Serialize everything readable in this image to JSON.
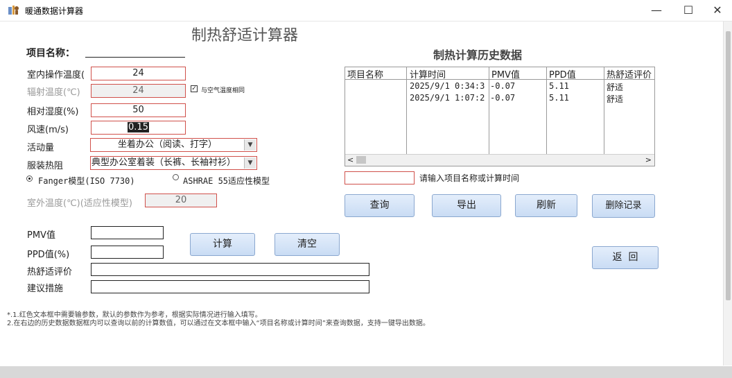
{
  "window": {
    "title": "暖通数据计算器",
    "min_glyph": "—",
    "max_glyph": "☐",
    "close_glyph": "✕"
  },
  "form": {
    "heading": "制热舒适计算器",
    "project_name_label": "项目名称：",
    "project_name_value": "",
    "indoor_temp_label": "室内操作温度(",
    "indoor_temp_value": "24",
    "radiant_temp_label": "辐射温度(℃)",
    "radiant_temp_value": "24",
    "same_as_air_label": "与空气温度相同",
    "same_as_air_checked": true,
    "humidity_label": "相对湿度(%)",
    "humidity_value": "50",
    "wind_label": "风速(m/s)",
    "wind_value": "0.15",
    "activity_label": "活动量",
    "activity_value": "坐着办公（阅读、打字）",
    "clothing_label": "服装热阻",
    "clothing_value": "典型办公室着装（长裤、长袖衬衫）",
    "model_fanger_label": "Fanger模型(ISO 7730)",
    "model_ashrae_label": "ASHRAE 55适应性模型",
    "selected_model": "fanger",
    "outdoor_temp_label": "室外温度(℃)(适应性模型)",
    "outdoor_temp_value": "20",
    "pmv_label": "PMV值",
    "pmv_value": "",
    "ppd_label": "PPD值(%)",
    "ppd_value": "",
    "comfort_label": "热舒适评价",
    "comfort_value": "",
    "advice_label": "建议措施",
    "advice_value": "",
    "calc_button": "计算",
    "clear_button": "清空"
  },
  "history": {
    "heading": "制热计算历史数据",
    "columns": [
      "项目名称",
      "计算时间",
      "PMV值",
      "PPD值",
      "热舒适评价"
    ],
    "rows": [
      [
        "",
        "2025/9/1 0:34:3",
        "-0.07",
        "5.11",
        "舒适"
      ],
      [
        "",
        "2025/9/1 1:07:2",
        "-0.07",
        "5.11",
        "舒适"
      ]
    ],
    "search_value": "",
    "search_hint": "请输入项目名称或计算时间",
    "query_button": "查询",
    "export_button": "导出",
    "refresh_button": "刷新",
    "delete_button": "删除记录",
    "back_button": "返  回",
    "scroll_left": "<",
    "scroll_right": ">"
  },
  "notes": {
    "line1": "*.1.红色文本框中需要输参数，默认的参数作为参考，根据实际情况进行输入填写。",
    "line2": "2.在右边的历史数据数据框内可以查询以前的计算数值，可以通过在文本框中输入“项目名称或计算时间”来查询数据，支持一键导出数据。"
  },
  "colors": {
    "required_border": "#d0504a",
    "button_fill": "#c9dcf4"
  }
}
